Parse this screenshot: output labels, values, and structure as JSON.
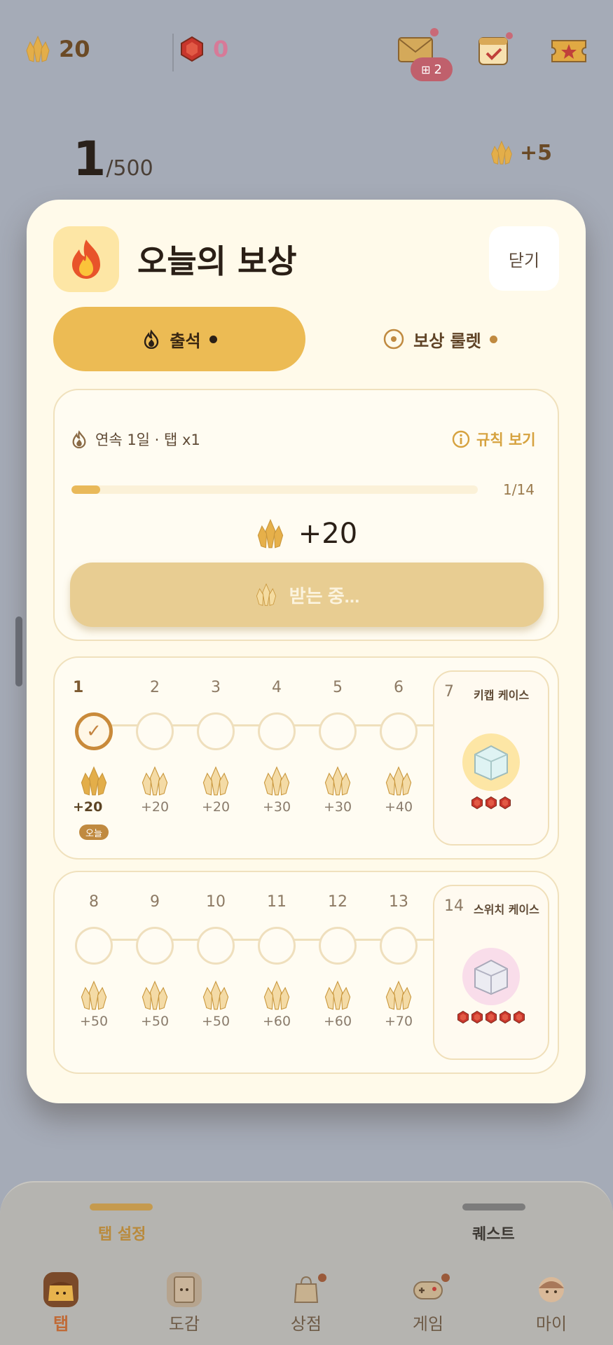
{
  "header": {
    "gems": "20",
    "rubies": "0",
    "mail_badge": "2",
    "progress_value": "1",
    "progress_total": "/500",
    "per_tap": "+5"
  },
  "modal": {
    "title": "오늘의 보상",
    "close_label": "닫기",
    "tabs": [
      {
        "label": "출석",
        "active": true,
        "dot_color": "#3a2712"
      },
      {
        "label": "보상 룰렛",
        "active": false,
        "dot_color": "#c08a40"
      }
    ],
    "streak": {
      "status": "연속 1일 · 탭 x1",
      "rules_label": "규칙 보기",
      "progress_fraction": 0.0714,
      "progress_text": "1/14",
      "reward_amount": "+20",
      "claim_label": "받는 중..."
    },
    "week1": {
      "days": [
        {
          "num": "1",
          "value": "+20",
          "checked": true,
          "today": "오늘"
        },
        {
          "num": "2",
          "value": "+20"
        },
        {
          "num": "3",
          "value": "+20"
        },
        {
          "num": "4",
          "value": "+30"
        },
        {
          "num": "5",
          "value": "+30"
        },
        {
          "num": "6",
          "value": "+40"
        }
      ],
      "case": {
        "num": "7",
        "name": "키캡 케이스",
        "rubies": 3
      }
    },
    "week2": {
      "days": [
        {
          "num": "8",
          "value": "+50"
        },
        {
          "num": "9",
          "value": "+50"
        },
        {
          "num": "10",
          "value": "+50"
        },
        {
          "num": "11",
          "value": "+60"
        },
        {
          "num": "12",
          "value": "+60"
        },
        {
          "num": "13",
          "value": "+70"
        }
      ],
      "case": {
        "num": "14",
        "name": "스위치 케이스",
        "rubies": 5
      }
    }
  },
  "bottom": {
    "sub_tabs": [
      "탭 설정",
      "퀘스트"
    ],
    "nav": [
      {
        "label": "탭",
        "icon": "pudding-icon",
        "active": true
      },
      {
        "label": "도감",
        "icon": "book-icon"
      },
      {
        "label": "상점",
        "icon": "shop-bag-icon",
        "dot": true
      },
      {
        "label": "게임",
        "icon": "gamepad-icon",
        "dot": true
      },
      {
        "label": "마이",
        "icon": "profile-icon"
      }
    ]
  },
  "colors": {
    "accent": "#ecbb54",
    "card_bg": "#fffaea",
    "overlay": "#a5abb7"
  }
}
